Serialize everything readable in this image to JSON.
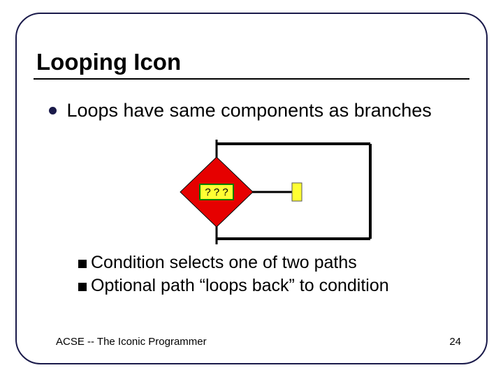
{
  "title": "Looping Icon",
  "main_bullet": "Loops have same components as branches",
  "diagram": {
    "decision_label": "? ? ?"
  },
  "sub_bullets": [
    "Condition selects one of two paths",
    "Optional path “loops back” to condition"
  ],
  "footer": {
    "left": "ACSE -- The Iconic Programmer",
    "page": "24"
  }
}
